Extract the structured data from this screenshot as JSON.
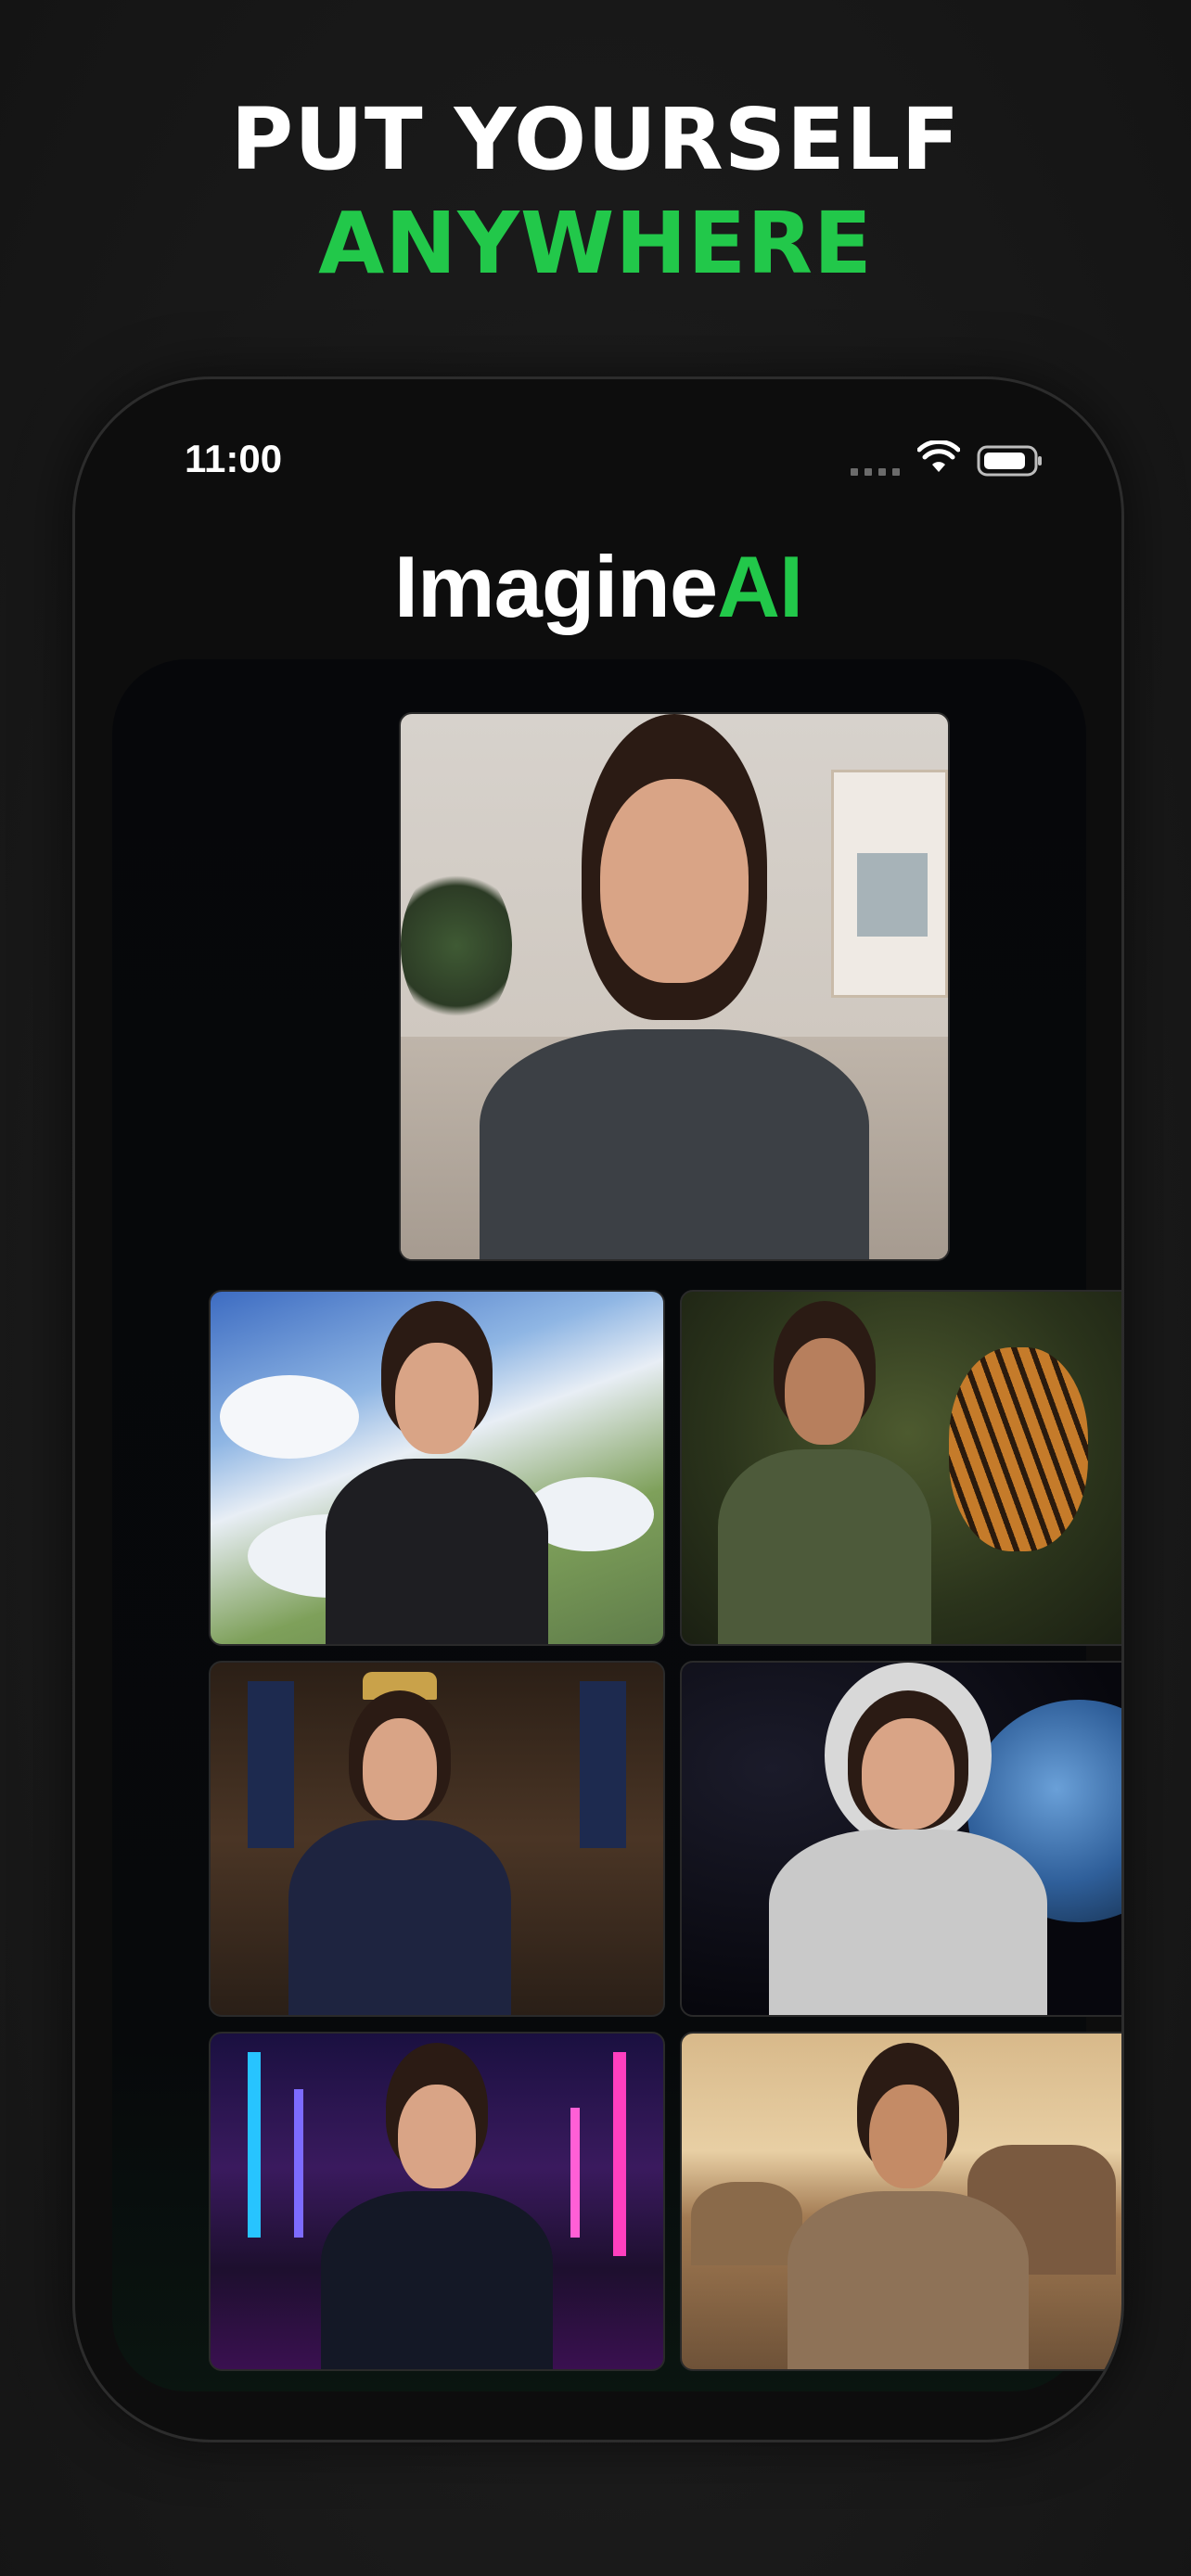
{
  "headline": {
    "line1": "PUT YOURSELF",
    "line2": "ANYWHERE"
  },
  "status_bar": {
    "time": "11:00"
  },
  "app": {
    "brand_prefix": "Imagine",
    "brand_suffix": "AI"
  },
  "colors": {
    "accent_green": "#22c84a",
    "background": "#141414"
  },
  "icons": [
    "signal-dots-icon",
    "wifi-icon",
    "battery-icon"
  ]
}
